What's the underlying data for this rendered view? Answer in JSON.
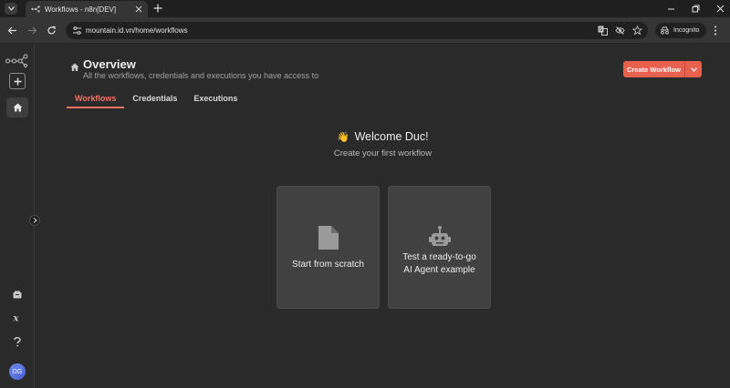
{
  "browser": {
    "tab_title": "Workflows - n8n[DEV]",
    "url": "mountain.id.vn/home/workflows",
    "incognito_label": "Incognito"
  },
  "sidebar": {
    "avatar_initials": "DG"
  },
  "header": {
    "title": "Overview",
    "subtitle": "All the workflows, credentials and executions you have access to",
    "create_button": "Create Workflow"
  },
  "tabs": [
    {
      "label": "Workflows",
      "active": true
    },
    {
      "label": "Credentials",
      "active": false
    },
    {
      "label": "Executions",
      "active": false
    }
  ],
  "welcome": {
    "emoji": "👋",
    "title": "Welcome Duc!",
    "subtitle": "Create your first workflow"
  },
  "cards": [
    {
      "label": "Start from scratch",
      "icon": "file-icon"
    },
    {
      "label_line1": "Test a ready-to-go",
      "label_line2": "AI Agent example",
      "icon": "robot-icon"
    }
  ],
  "colors": {
    "accent": "#e8614f",
    "background": "#2a2a2a",
    "card": "#414141"
  }
}
